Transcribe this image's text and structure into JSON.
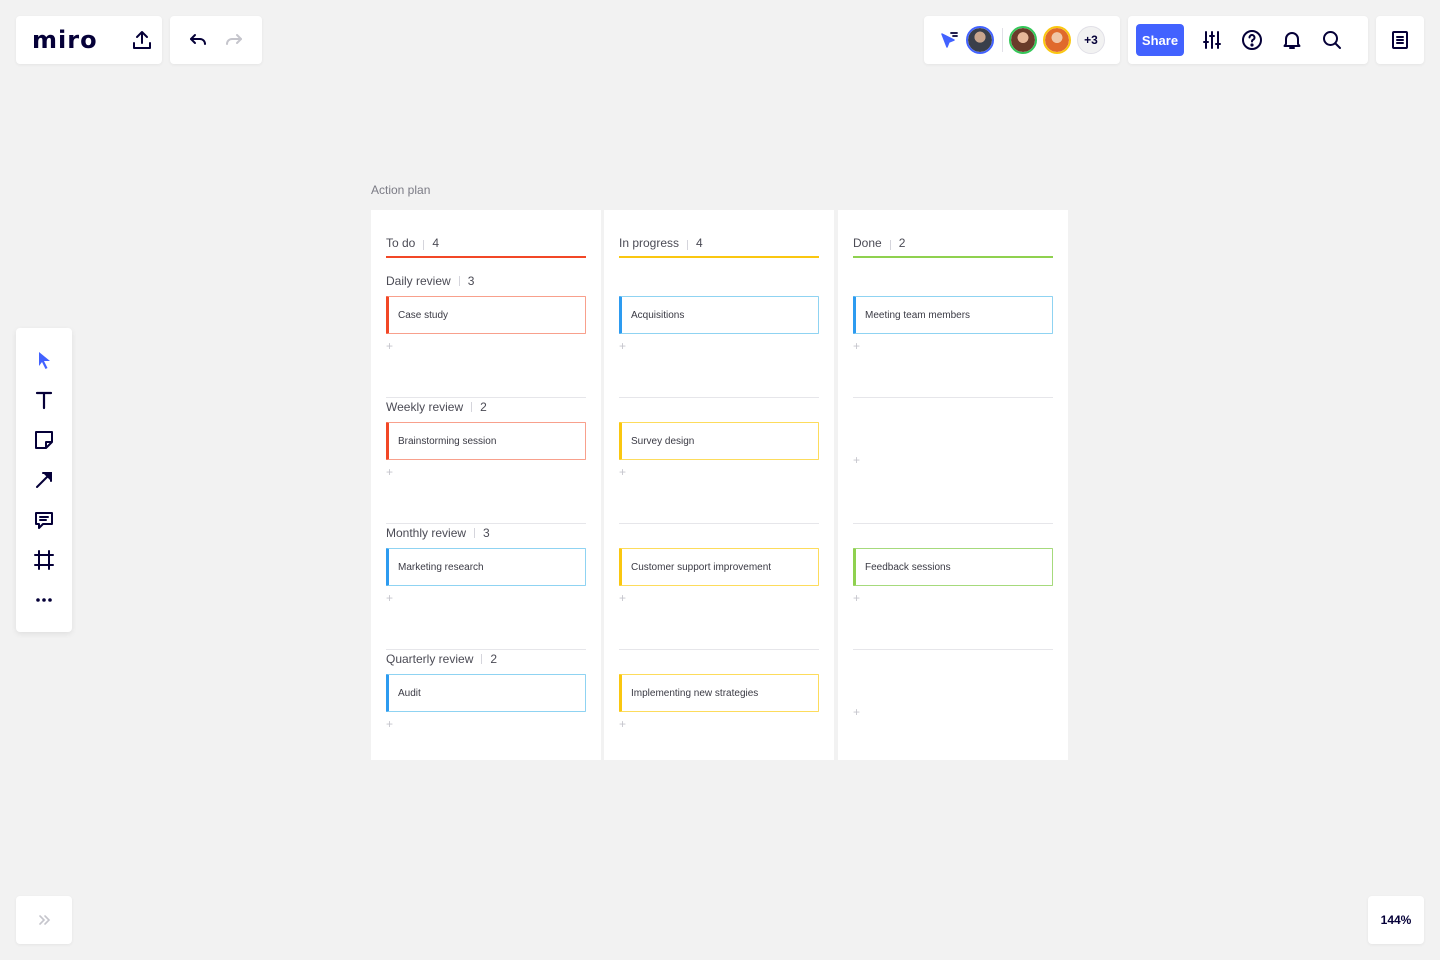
{
  "app": {
    "logo": "miro",
    "share_label": "Share",
    "avatar_overflow": "+3",
    "zoom": "144%"
  },
  "colors": {
    "accent": "#4262ff",
    "todo": "#f24726",
    "in_progress": "#fac710",
    "done": "#8fd14f",
    "blue_card": "#2d9bf0"
  },
  "toolbar_icons": [
    "select-icon",
    "text-icon",
    "sticky-note-icon",
    "line-icon",
    "comment-icon",
    "frame-icon",
    "more-icon"
  ],
  "board": {
    "title": "Action plan",
    "columns": [
      {
        "name": "To do",
        "count": "4",
        "groups": [
          {
            "title": "Daily review",
            "count": "3",
            "card": "Case study"
          },
          {
            "title": "Weekly review",
            "count": "2",
            "card": "Brainstorming session"
          },
          {
            "title": "Monthly review",
            "count": "3",
            "card": "Marketing research"
          },
          {
            "title": "Quarterly review",
            "count": "2",
            "card": "Audit"
          }
        ]
      },
      {
        "name": "In progress",
        "count": "4",
        "groups": [
          {
            "card": "Acquisitions"
          },
          {
            "card": "Survey design"
          },
          {
            "card": "Customer support improvement"
          },
          {
            "card": "Implementing new strategies"
          }
        ]
      },
      {
        "name": "Done",
        "count": "2",
        "groups": [
          {
            "card": "Meeting team members"
          },
          {
            "card": ""
          },
          {
            "card": "Feedback sessions"
          },
          {
            "card": ""
          }
        ]
      }
    ]
  }
}
